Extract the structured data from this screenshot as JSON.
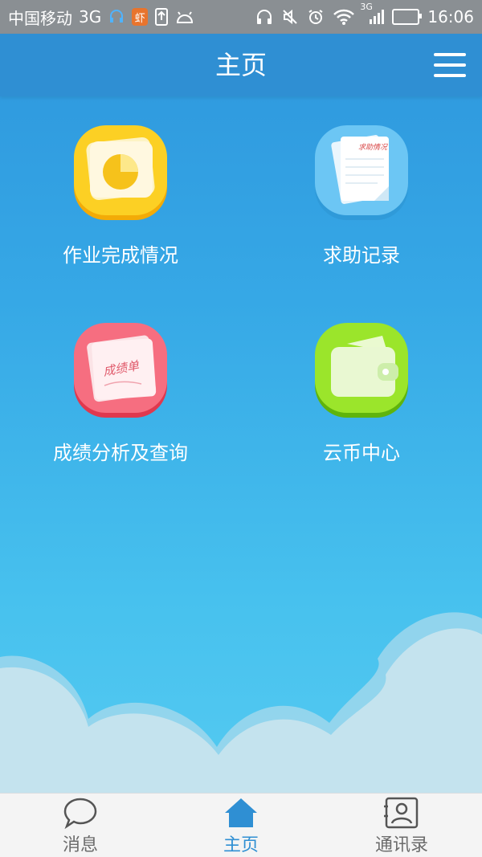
{
  "status_bar": {
    "carrier": "中国移动",
    "network": "3G",
    "app_badge": "虾",
    "signal_label": "3G",
    "time": "16:06"
  },
  "header": {
    "title": "主页"
  },
  "grid": [
    {
      "label": "作业完成情况",
      "icon": "pie-chart-note-icon",
      "color": "#f5b90e"
    },
    {
      "label": "求助记录",
      "icon": "documents-icon",
      "color": "#56b6ef"
    },
    {
      "label": "成绩分析及查询",
      "icon": "grade-report-icon",
      "color": "#f0566b"
    },
    {
      "label": "云币中心",
      "icon": "wallet-icon",
      "color": "#86d81d"
    }
  ],
  "tabbar": {
    "items": [
      {
        "label": "消息",
        "icon": "chat-bubble-icon",
        "active": false
      },
      {
        "label": "主页",
        "icon": "home-icon",
        "active": true
      },
      {
        "label": "通讯录",
        "icon": "contacts-icon",
        "active": false
      }
    ]
  },
  "colors": {
    "header_bg": "#2f8fd3",
    "active_tab": "#2f8fd3",
    "inactive_tab": "#6b6b6b"
  }
}
